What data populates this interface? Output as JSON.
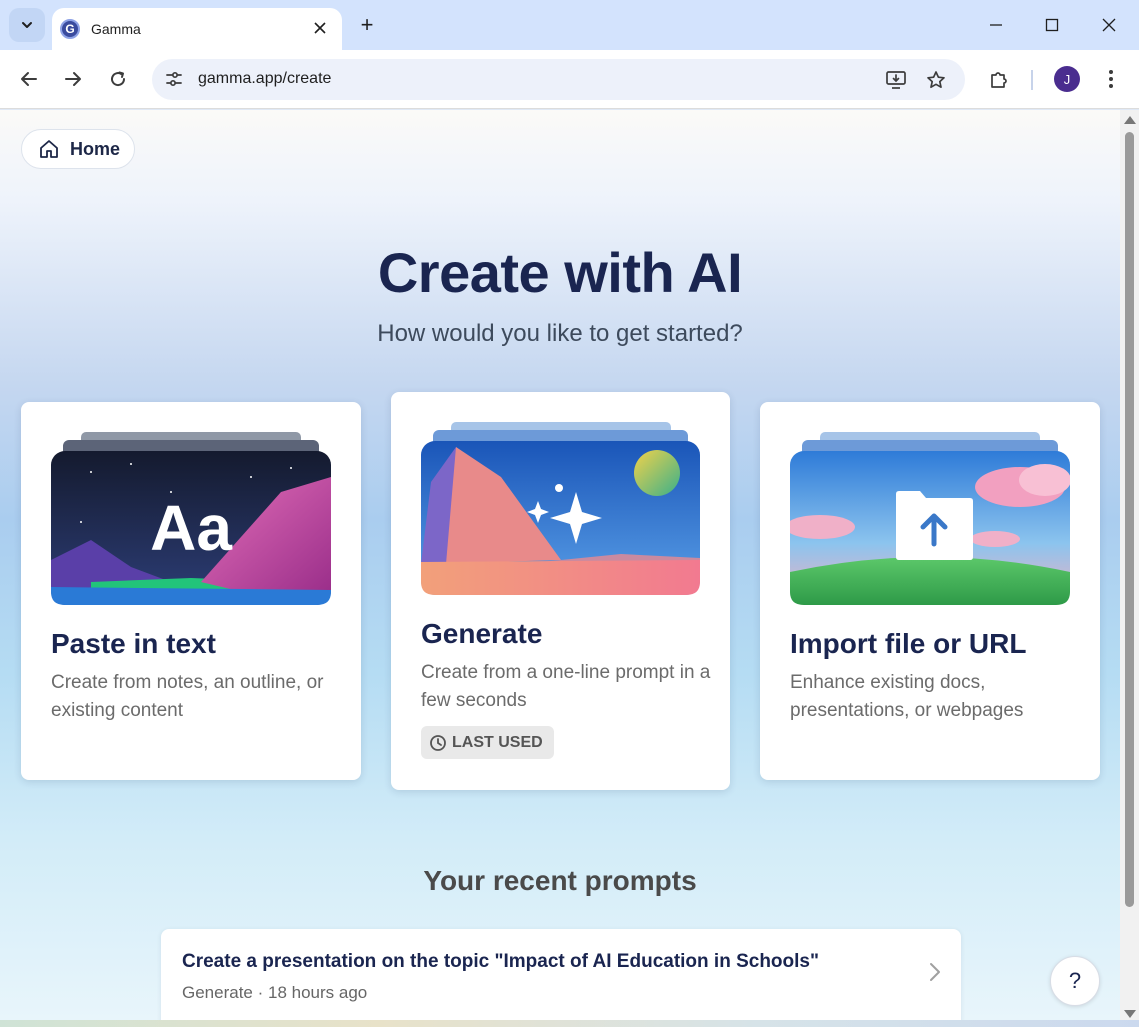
{
  "browser": {
    "tab_title": "Gamma",
    "favicon_letter": "G",
    "new_tab_symbol": "+",
    "url": "gamma.app/create",
    "profile_initial": "J"
  },
  "page": {
    "home_label": "Home",
    "title": "Create with AI",
    "subtitle": "How would you like to get started?",
    "cards": [
      {
        "title": "Paste in text",
        "description": "Create from notes, an outline, or existing content",
        "art_text": "Aa"
      },
      {
        "title": "Generate",
        "description": "Create from a one-line prompt in a few seconds",
        "badge": "LAST USED"
      },
      {
        "title": "Import file or URL",
        "description": "Enhance existing docs, presentations, or webpages"
      }
    ],
    "recent_heading": "Your recent prompts",
    "recent_prompts": [
      {
        "text": "Create a presentation on the topic \"Impact of AI Education in Schools\"",
        "meta": "Generate · 18 hours ago"
      }
    ],
    "help_label": "?"
  }
}
